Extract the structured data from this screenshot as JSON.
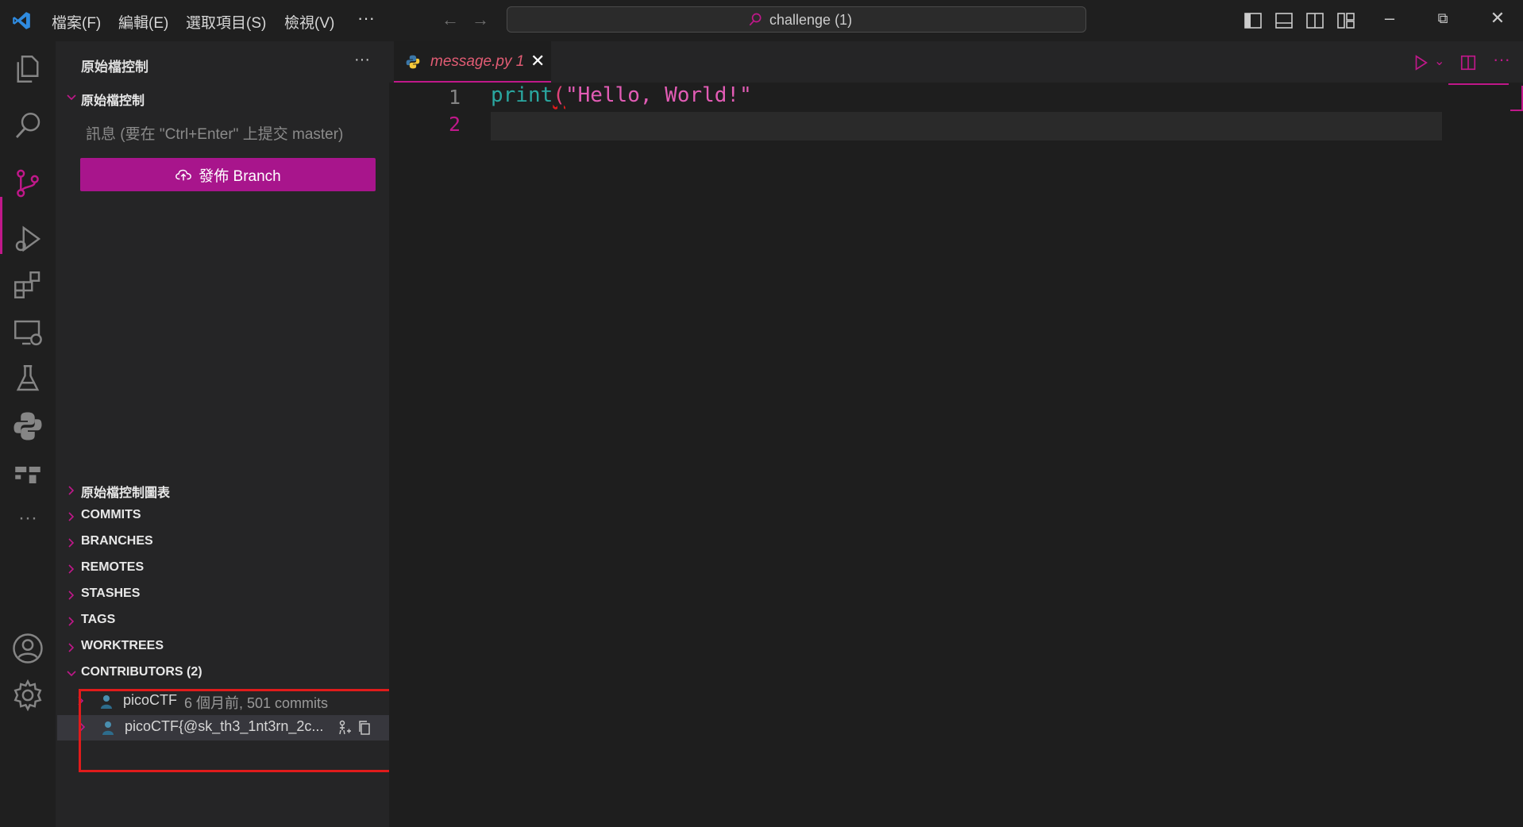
{
  "menu": {
    "file": "檔案(F)",
    "edit": "編輯(E)",
    "selection": "選取項目(S)",
    "view": "檢視(V)",
    "more": "···"
  },
  "search": {
    "text": "challenge (1)"
  },
  "sidebar": {
    "header": "原始檔控制",
    "more": "···",
    "section": "原始檔控制",
    "commit_placeholder": "訊息 (要在 \"Ctrl+Enter\" 上提交 master)",
    "publish_label": "發佈 Branch",
    "sections": [
      "原始檔控制圖表",
      "COMMITS",
      "BRANCHES",
      "REMOTES",
      "STASHES",
      "TAGS",
      "WORKTREES"
    ],
    "contributors_title": "CONTRIBUTORS (2)",
    "contributors": [
      {
        "name": "picoCTF",
        "meta": "6 個月前, 501 commits"
      },
      {
        "name": "picoCTF{@sk_th3_1nt3rn_2c...",
        "meta": ""
      }
    ]
  },
  "editor": {
    "tab_name": "message.py",
    "tab_badge": "1",
    "lines": [
      {
        "num": "1",
        "fn": "print",
        "paren": "(",
        "str": "\"Hello, World!\""
      },
      {
        "num": "2"
      }
    ]
  },
  "colors": {
    "accent": "#c0188a",
    "button": "#a8158c",
    "highlight_box": "#e01b1b"
  }
}
